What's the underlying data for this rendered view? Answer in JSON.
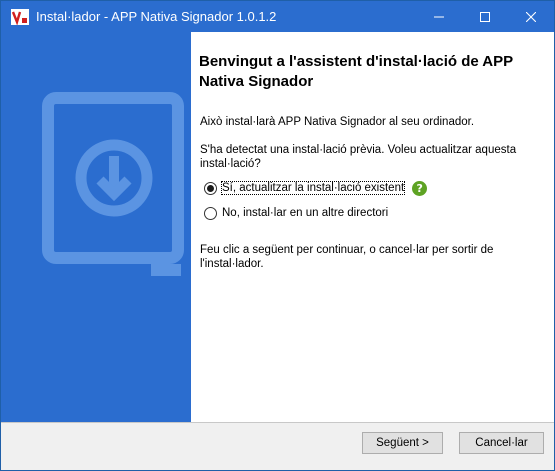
{
  "window": {
    "title": "Instal·lador - APP Nativa Signador 1.0.1.2",
    "accent_color": "#2b6dcf"
  },
  "titlebar_icons": [
    "minimize-icon",
    "maximize-icon",
    "close-icon"
  ],
  "sidebar": {
    "graphic": "monitor-download-icon"
  },
  "content": {
    "heading": "Benvingut a l'assistent d'instal·lació de APP Nativa Signador",
    "intro": "Això instal·larà APP Nativa Signador al seu ordinador.",
    "question": "S'ha detectat una instal·lació prèvia. Voleu actualitzar aquesta instal·lació?",
    "options": [
      {
        "label": "Sí, actualitzar la instal·lació existent",
        "checked": true
      },
      {
        "label": "No, instal·lar en un altre directori",
        "checked": false
      }
    ],
    "help_glyph": "?",
    "instructions": "Feu clic a següent per continuar, o cancel·lar per sortir de l'instal·lador."
  },
  "buttons": {
    "next": "Següent >",
    "cancel": "Cancel·lar"
  }
}
